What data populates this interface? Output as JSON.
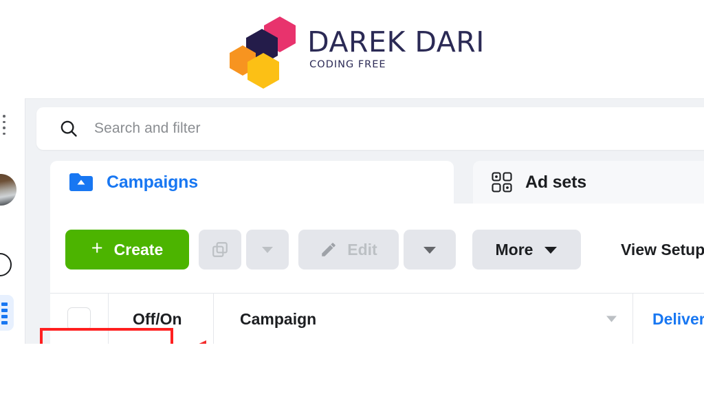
{
  "branding": {
    "title": "DAREK DARI",
    "tagline": "CODING FREE",
    "hex_colors": {
      "pink": "#e8336d",
      "navy": "#241c4a",
      "orange": "#f79420",
      "yellow": "#fcc015"
    },
    "text_color": "#2b2a55"
  },
  "sidebar": {
    "items": [
      {
        "name": "menu-dots",
        "icon": "dots-icon"
      },
      {
        "name": "profile-avatar",
        "icon": "avatar-icon"
      },
      {
        "name": "account-circle",
        "icon": "circle-icon"
      },
      {
        "name": "campaigns-list",
        "icon": "list-icon",
        "active": true
      }
    ]
  },
  "search": {
    "placeholder": "Search and filter",
    "icon": "search-icon"
  },
  "tabs": [
    {
      "label": "Campaigns",
      "icon": "folder-campaign-icon",
      "active": true,
      "color": "#1877f2"
    },
    {
      "label": "Ad sets",
      "icon": "grid-adsets-icon",
      "active": false,
      "color": "#1c1e21"
    }
  ],
  "toolbar": {
    "create_label": "Create",
    "create_plus": "+",
    "create_color": "#4cb400",
    "duplicate_label": "",
    "duplicate_caret": "",
    "edit_label": "Edit",
    "edit_caret": "",
    "more_label": "More",
    "more_caret": "",
    "view_setup_label": "View Setup"
  },
  "table": {
    "columns": [
      {
        "label": "",
        "name": "select-all-checkbox"
      },
      {
        "label": "Off/On",
        "name": "column-offon"
      },
      {
        "label": "Campaign",
        "name": "column-campaign"
      },
      {
        "label": "Delivery",
        "name": "column-delivery",
        "color": "#1877f2"
      }
    ]
  },
  "annotations": {
    "highlight_color": "#ff2020",
    "arrow_color": "#f42c2c",
    "target": "Create"
  }
}
